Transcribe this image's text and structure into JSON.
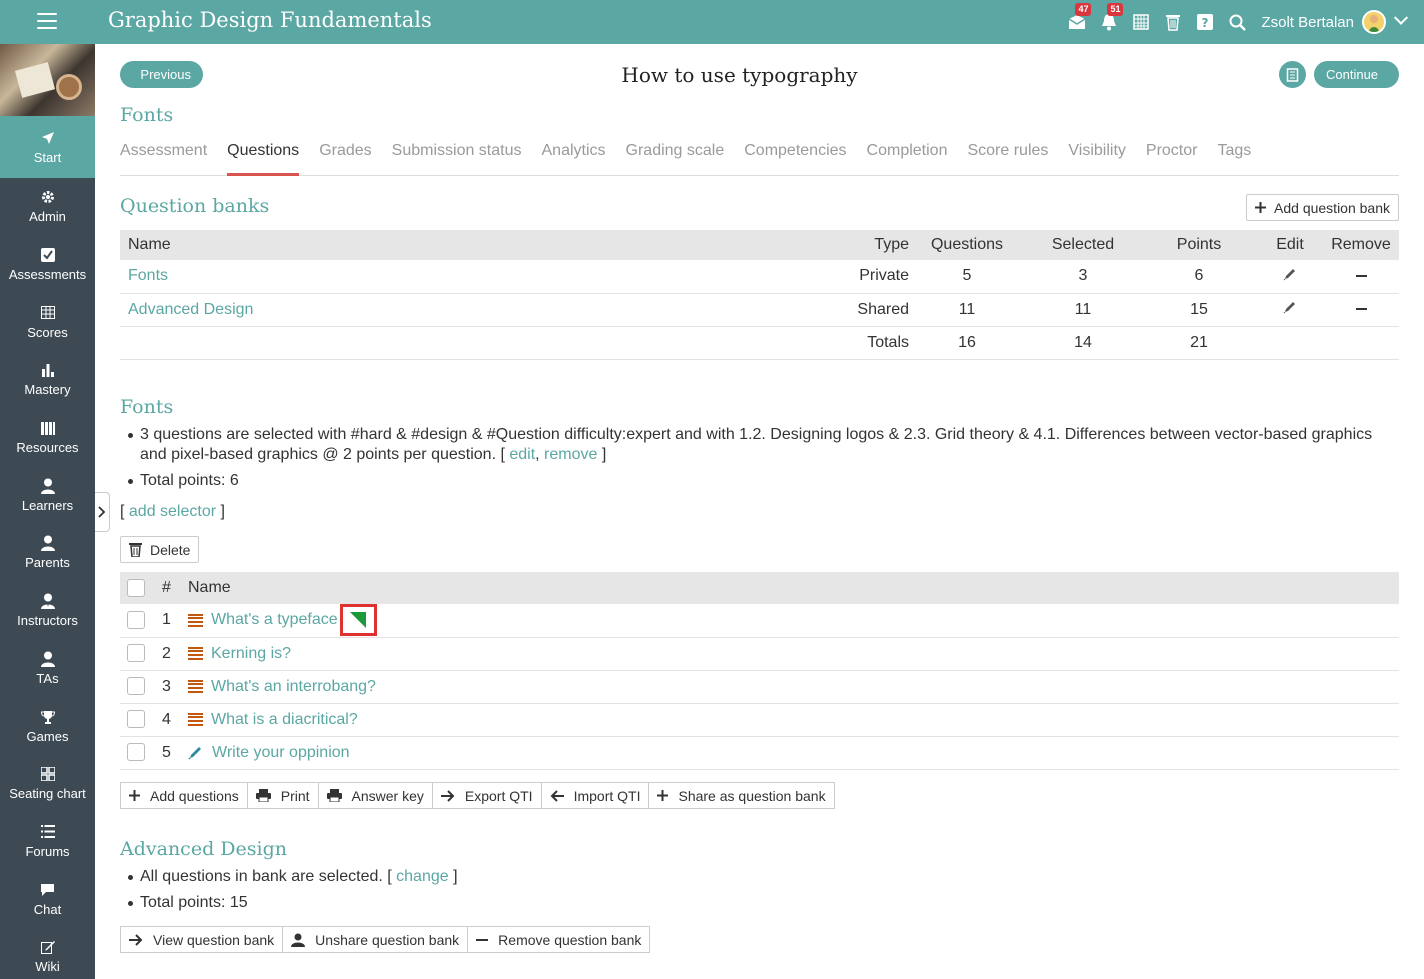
{
  "app": {
    "title": "Graphic Design Fundamentals",
    "user_name": "Zsolt Bertalan",
    "messages_badge": "47",
    "notifications_badge": "51"
  },
  "sidebar": {
    "items": [
      {
        "label": "Start",
        "icon": "send-icon"
      },
      {
        "label": "Admin",
        "icon": "gear-icon"
      },
      {
        "label": "Assessments",
        "icon": "checkbox-icon"
      },
      {
        "label": "Scores",
        "icon": "table-icon"
      },
      {
        "label": "Mastery",
        "icon": "bar-chart-icon"
      },
      {
        "label": "Resources",
        "icon": "books-icon"
      },
      {
        "label": "Learners",
        "icon": "person-icon"
      },
      {
        "label": "Parents",
        "icon": "person-icon"
      },
      {
        "label": "Instructors",
        "icon": "instructor-icon"
      },
      {
        "label": "TAs",
        "icon": "person-icon"
      },
      {
        "label": "Games",
        "icon": "trophy-icon"
      },
      {
        "label": "Seating chart",
        "icon": "grid-icon"
      },
      {
        "label": "Forums",
        "icon": "list-icon"
      },
      {
        "label": "Chat",
        "icon": "chat-icon"
      },
      {
        "label": "Wiki",
        "icon": "edit-icon"
      }
    ]
  },
  "header": {
    "previous_label": "Previous",
    "continue_label": "Continue",
    "page_title": "How to use typography",
    "section_title": "Fonts"
  },
  "tabs": [
    {
      "label": "Assessment"
    },
    {
      "label": "Questions",
      "active": true
    },
    {
      "label": "Grades"
    },
    {
      "label": "Submission status"
    },
    {
      "label": "Analytics"
    },
    {
      "label": "Grading scale"
    },
    {
      "label": "Competencies"
    },
    {
      "label": "Completion"
    },
    {
      "label": "Score rules"
    },
    {
      "label": "Visibility"
    },
    {
      "label": "Proctor"
    },
    {
      "label": "Tags"
    }
  ],
  "question_banks": {
    "title": "Question banks",
    "add_label": "Add question bank",
    "columns": [
      "Name",
      "Type",
      "Questions",
      "Selected",
      "Points",
      "Edit",
      "Remove"
    ],
    "rows": [
      {
        "name": "Fonts",
        "type": "Private",
        "questions": "5",
        "selected": "3",
        "points": "6"
      },
      {
        "name": "Advanced Design",
        "type": "Shared",
        "questions": "11",
        "selected": "11",
        "points": "15"
      }
    ],
    "totals": {
      "label": "Totals",
      "questions": "16",
      "selected": "14",
      "points": "21"
    }
  },
  "fonts_bank": {
    "title": "Fonts",
    "selector_text": "3 questions are selected with #hard & #design & #Question difficulty:expert and with 1.2. Designing logos & 2.3. Grid theory & 4.1. Differences between vector-based graphics and pixel-based graphics @ 2 points per question.",
    "edit_label": "edit",
    "remove_label": "remove",
    "total_points": "Total points: 6",
    "add_selector_label": "add selector",
    "delete_label": "Delete",
    "columns": {
      "number": "#",
      "name": "Name"
    },
    "questions": [
      {
        "num": "1",
        "name": "What's a typeface",
        "icon": "list-icon",
        "flag": true
      },
      {
        "num": "2",
        "name": "Kerning is?",
        "icon": "list-icon"
      },
      {
        "num": "3",
        "name": "What's an interrobang?",
        "icon": "list-icon"
      },
      {
        "num": "4",
        "name": "What is a diacritical?",
        "icon": "list-icon"
      },
      {
        "num": "5",
        "name": "Write your oppinion",
        "icon": "pencil-icon"
      }
    ],
    "actions": [
      "Add questions",
      "Print",
      "Answer key",
      "Export QTI",
      "Import QTI",
      "Share as question bank"
    ]
  },
  "advanced_bank": {
    "title": "Advanced Design",
    "selector_text": "All questions in bank are selected.",
    "change_label": "change",
    "total_points": "Total points: 15",
    "actions": [
      "View question bank",
      "Unshare question bank",
      "Remove question bank"
    ]
  },
  "colors": {
    "brand": "#5ba7a3",
    "sidebar": "#3e4a53",
    "active_tab_underline": "#d9534f",
    "list_icon": "#c2570f",
    "flag_border": "#e03131",
    "flag_fill": "#1a9a3a"
  }
}
